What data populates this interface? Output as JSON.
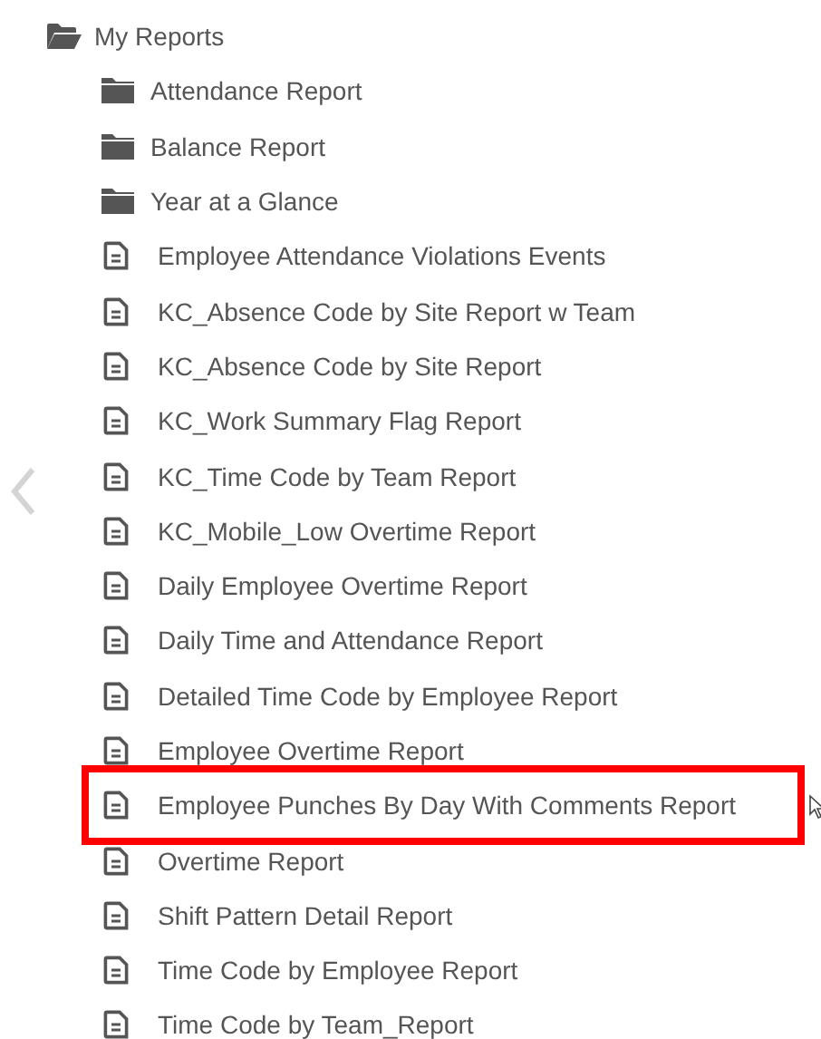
{
  "tree": {
    "label": "My Reports",
    "expanded": true,
    "children": [
      {
        "kind": "folder",
        "label": "Attendance Report",
        "highlighted": false
      },
      {
        "kind": "folder",
        "label": "Balance Report",
        "highlighted": false
      },
      {
        "kind": "folder",
        "label": "Year at a Glance",
        "highlighted": false
      },
      {
        "kind": "report",
        "label": "Employee Attendance Violations Events",
        "highlighted": false
      },
      {
        "kind": "report",
        "label": "KC_Absence Code by Site Report w Team",
        "highlighted": false
      },
      {
        "kind": "report",
        "label": "KC_Absence Code by Site Report",
        "highlighted": false
      },
      {
        "kind": "report",
        "label": "KC_Work Summary Flag Report",
        "highlighted": false
      },
      {
        "kind": "report",
        "label": "KC_Time Code by Team Report",
        "highlighted": false
      },
      {
        "kind": "report",
        "label": "KC_Mobile_Low Overtime Report",
        "highlighted": false
      },
      {
        "kind": "report",
        "label": "Daily Employee Overtime Report",
        "highlighted": false
      },
      {
        "kind": "report",
        "label": "Daily Time and Attendance Report",
        "highlighted": false
      },
      {
        "kind": "report",
        "label": "Detailed Time Code by Employee Report",
        "highlighted": false
      },
      {
        "kind": "report",
        "label": "Employee Overtime Report",
        "highlighted": false
      },
      {
        "kind": "report",
        "label": "Employee Punches By Day With Comments Report",
        "highlighted": true
      },
      {
        "kind": "report",
        "label": "Overtime Report",
        "highlighted": false
      },
      {
        "kind": "report",
        "label": "Shift Pattern Detail Report",
        "highlighted": false
      },
      {
        "kind": "report",
        "label": "Time Code by Employee Report",
        "highlighted": false
      },
      {
        "kind": "report",
        "label": "Time Code by Team_Report",
        "highlighted": false
      }
    ]
  }
}
